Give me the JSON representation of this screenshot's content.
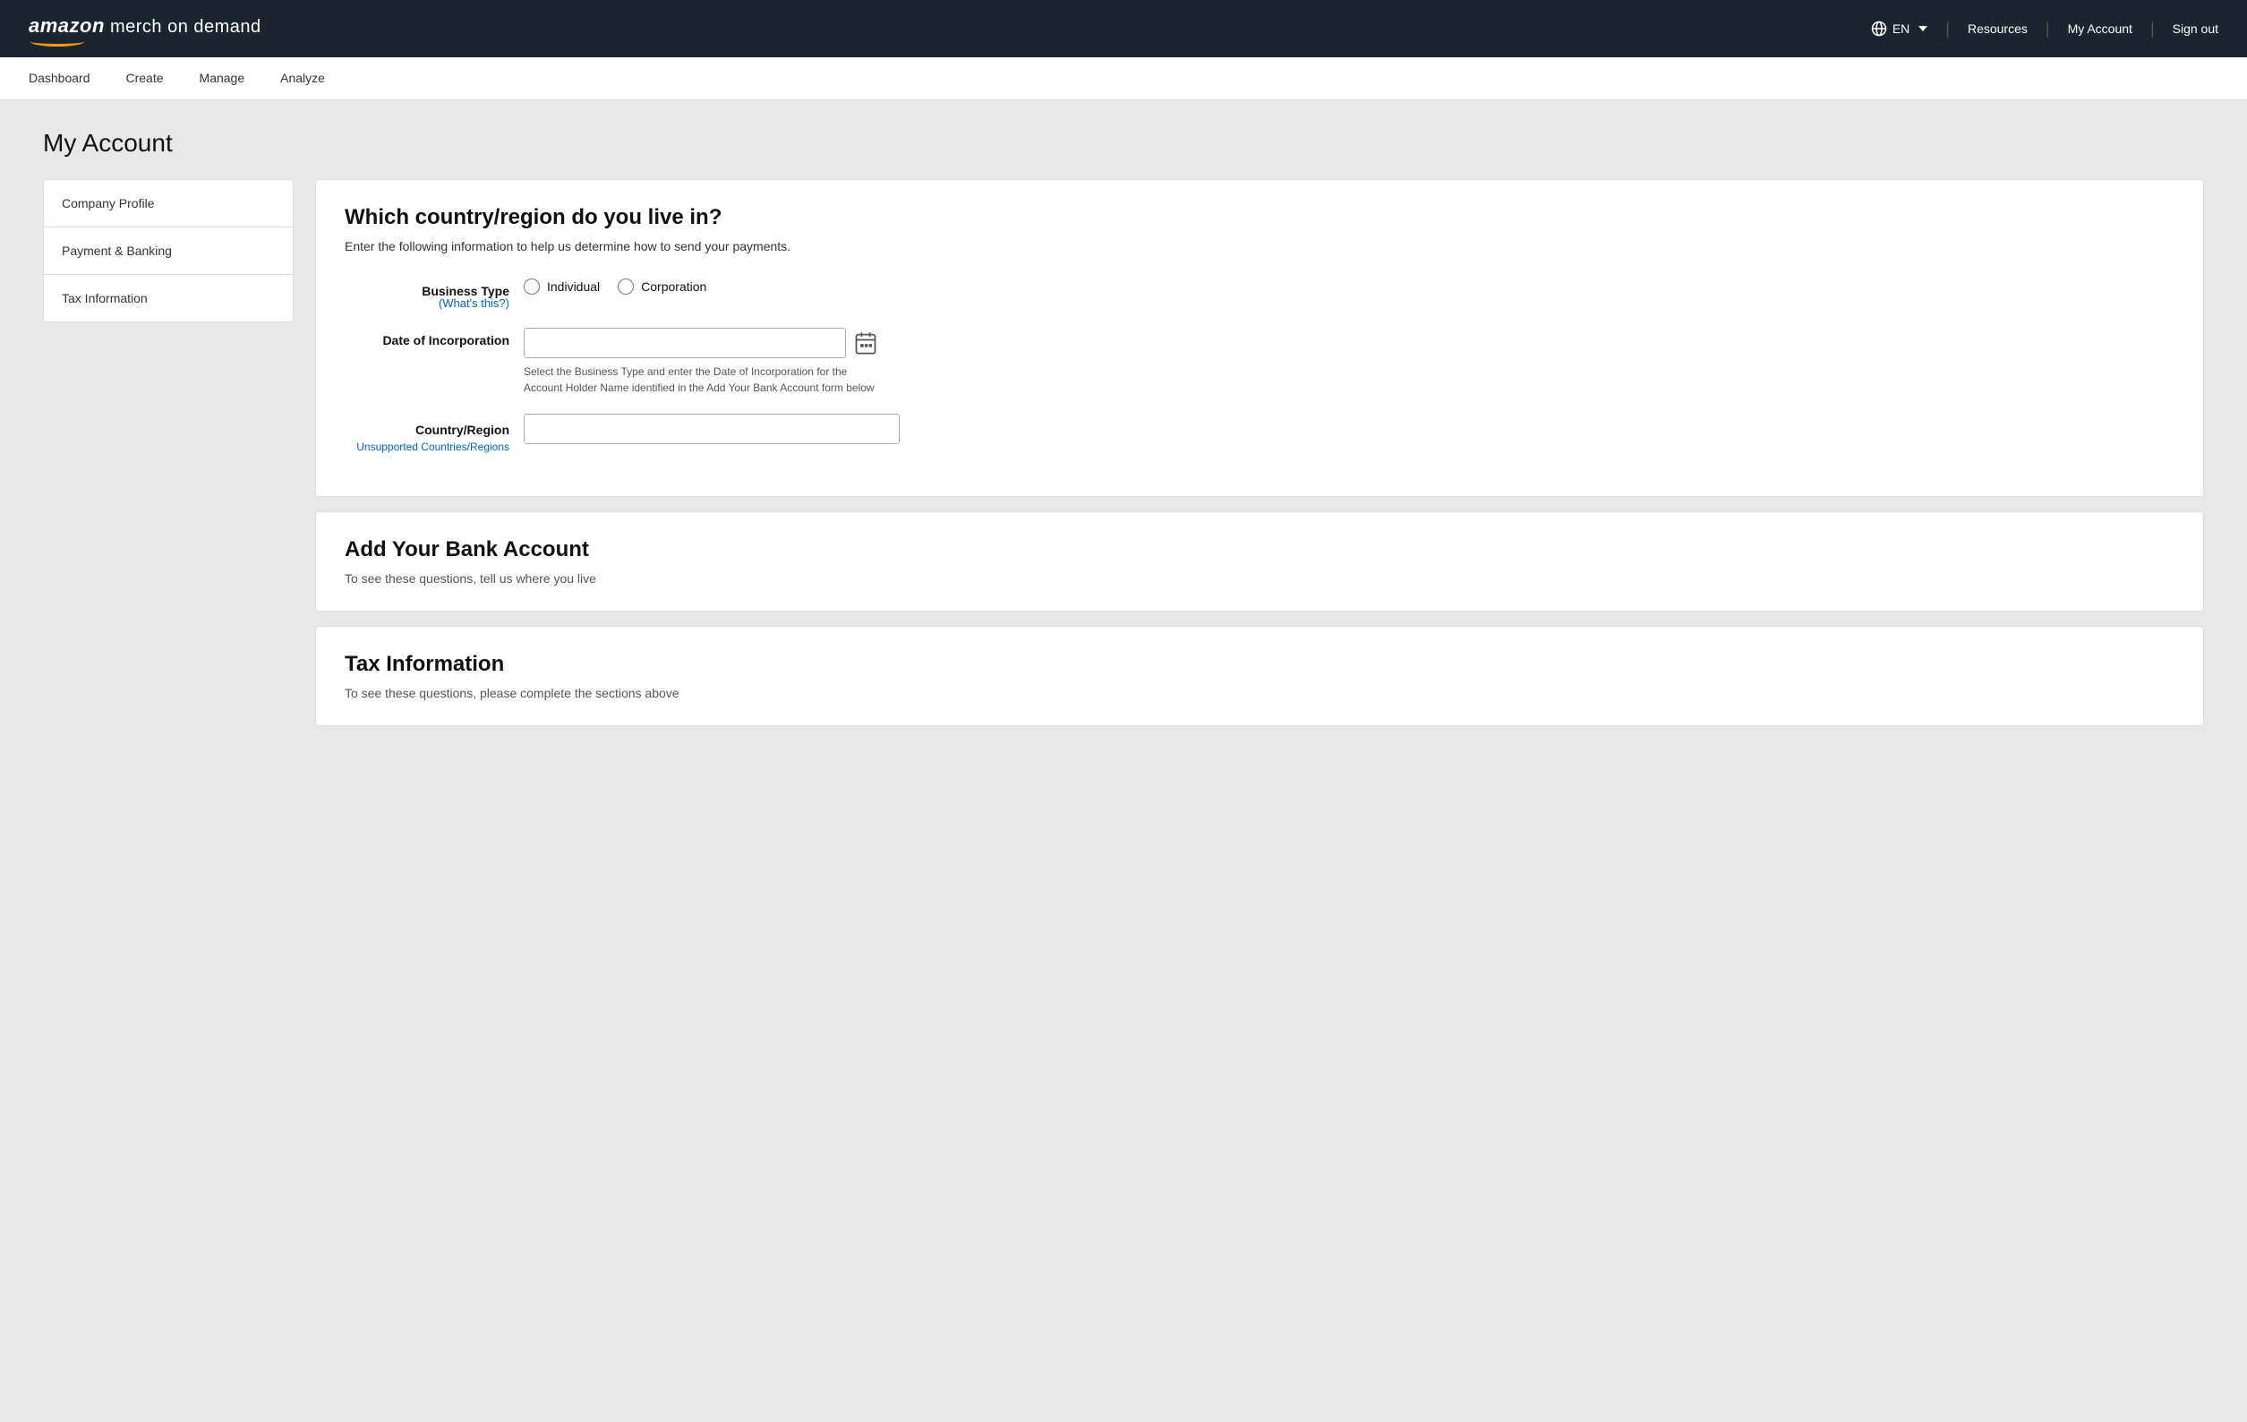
{
  "header": {
    "logo": {
      "amazon": "amazon",
      "rest": " merch on demand"
    },
    "lang": {
      "code": "EN",
      "icon": "globe"
    },
    "links": {
      "resources": "Resources",
      "my_account": "My Account",
      "sign_out": "Sign out"
    }
  },
  "top_nav": {
    "items": [
      {
        "label": "Dashboard",
        "id": "dashboard"
      },
      {
        "label": "Create",
        "id": "create"
      },
      {
        "label": "Manage",
        "id": "manage"
      },
      {
        "label": "Analyze",
        "id": "analyze"
      }
    ]
  },
  "page": {
    "title": "My Account"
  },
  "sidebar": {
    "items": [
      {
        "label": "Company Profile",
        "id": "company-profile"
      },
      {
        "label": "Payment & Banking",
        "id": "payment-banking"
      },
      {
        "label": "Tax Information",
        "id": "tax-information"
      }
    ]
  },
  "panels": {
    "country_panel": {
      "title": "Which country/region do you live in?",
      "subtitle": "Enter the following information to help us determine how to send your payments.",
      "business_type": {
        "label": "Business Type",
        "whats_this": "(What's this?)",
        "options": [
          {
            "label": "Individual",
            "value": "individual"
          },
          {
            "label": "Corporation",
            "value": "corporation"
          }
        ]
      },
      "date_of_incorporation": {
        "label": "Date of Incorporation",
        "placeholder": "",
        "hint": "Select the Business Type and enter the Date of Incorporation for the Account Holder Name identified in the Add Your Bank Account form below"
      },
      "country_region": {
        "label": "Country/Region",
        "unsupported_link": "Unsupported Countries/Regions",
        "placeholder": ""
      }
    },
    "bank_panel": {
      "title": "Add Your Bank Account",
      "info": "To see these questions, tell us where you live"
    },
    "tax_panel": {
      "title": "Tax Information",
      "info": "To see these questions, please complete the sections above"
    }
  }
}
